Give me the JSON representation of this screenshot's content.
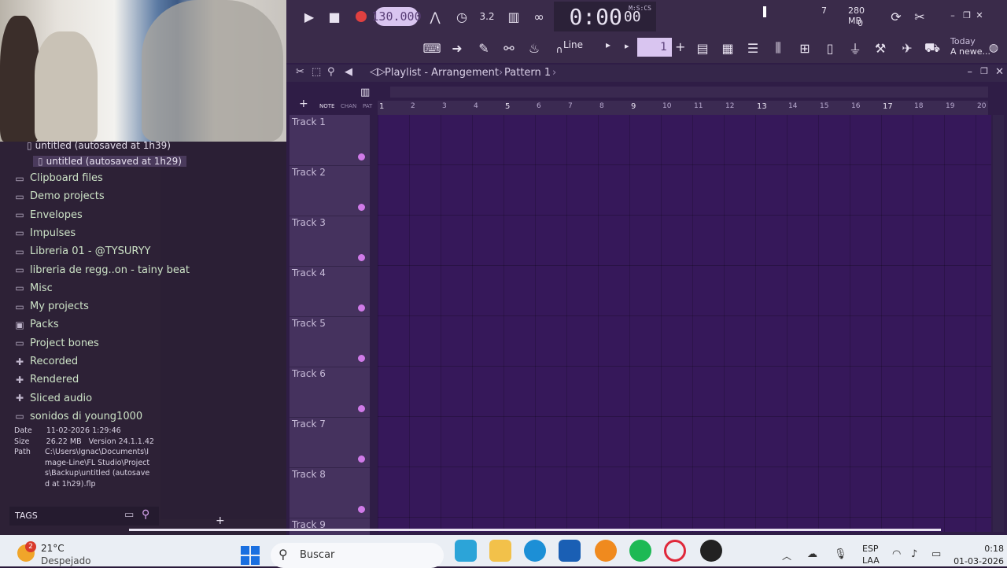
{
  "toolbar": {
    "tempo": "130.000",
    "time": "0:00",
    "time_frac": "00",
    "time_unit": "M:S:CS",
    "memory": "280 MB",
    "cpu_value": "7",
    "voices": "0",
    "snap": "Line",
    "pattern_number": "1",
    "news_title": "Today",
    "news_text": "A newe..."
  },
  "browser": {
    "files": [
      {
        "label": "untitled (autosaved at 1h39)"
      },
      {
        "label": "untitled (autosaved at 1h29)"
      }
    ],
    "folders": [
      {
        "label": "Clipboard files",
        "icon": "folder-icon"
      },
      {
        "label": "Demo projects",
        "icon": "folder-icon"
      },
      {
        "label": "Envelopes",
        "icon": "folder-icon"
      },
      {
        "label": "Impulses",
        "icon": "folder-icon"
      },
      {
        "label": "Libreria 01 - @TYSURYY",
        "icon": "folder-icon"
      },
      {
        "label": "libreria de regg..on - tainy beat",
        "icon": "folder-icon"
      },
      {
        "label": "Misc",
        "icon": "folder-icon"
      },
      {
        "label": "My projects",
        "icon": "folder-icon"
      },
      {
        "label": "Packs",
        "icon": "packs-icon"
      },
      {
        "label": "Project bones",
        "icon": "folder-icon"
      },
      {
        "label": "Recorded",
        "icon": "recorded-icon"
      },
      {
        "label": "Rendered",
        "icon": "rendered-icon"
      },
      {
        "label": "Sliced audio",
        "icon": "sliced-icon"
      },
      {
        "label": "sonidos di young1000",
        "icon": "folder-icon"
      }
    ],
    "info": {
      "date_label": "Date",
      "date": "11-02-2026 1:29:46",
      "size_label": "Size",
      "size": "26.22 MB",
      "version_label": "Version",
      "version": "24.1.1.42",
      "path_label": "Path",
      "path": "C:\\Users\\Ignac\\Documents\\Image-Line\\FL Studio\\Projects\\Backup\\untitled (autosaved at 1h29).flp"
    },
    "tags_label": "TAGS"
  },
  "playlist": {
    "title": "Playlist - Arrangement",
    "pattern": "Pattern 1",
    "mini_labels": [
      "NOTE",
      "CHAN",
      "PAT"
    ],
    "ruler": [
      "1",
      "2",
      "3",
      "4",
      "5",
      "6",
      "7",
      "8",
      "9",
      "10",
      "11",
      "12",
      "13",
      "14",
      "15",
      "16",
      "17",
      "18",
      "19",
      "20"
    ],
    "tracks": [
      "Track 1",
      "Track 2",
      "Track 3",
      "Track 4",
      "Track 5",
      "Track 6",
      "Track 7",
      "Track 8",
      "Track 9"
    ]
  },
  "taskbar": {
    "temperature": "21°C",
    "weather": "Despejado",
    "search_placeholder": "Buscar",
    "lang": "ESP",
    "lang2": "LAA",
    "clock_time": "0:18",
    "clock_date": "01-03-2026",
    "weather_badge": "2"
  }
}
